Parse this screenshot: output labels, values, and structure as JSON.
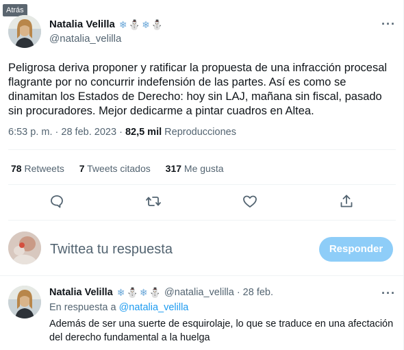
{
  "tooltip": {
    "back": "Atrás"
  },
  "main_tweet": {
    "display_name": "Natalia Velilla",
    "name_emojis": [
      "❄",
      "⛄",
      "❄",
      "⛄"
    ],
    "handle": "@natalia_velilla",
    "more": "···",
    "text": "Peligrosa deriva proponer y ratificar la propuesta de una infracción procesal flagrante por no concurrir indefensión de las partes. Así es como se dinamitan los Estados de Derecho: hoy sin LAJ, mañana sin fiscal, pasado sin procuradores. Mejor dedicarme a pintar cuadros en Altea.",
    "time": "6:53 p. m.",
    "date": "28 feb. 2023",
    "separator": "·",
    "views_count": "82,5 mil",
    "views_label": "Reproducciones",
    "stats": {
      "retweets_count": "78",
      "retweets_label": "Retweets",
      "quotes_count": "7",
      "quotes_label": "Tweets citados",
      "likes_count": "317",
      "likes_label": "Me gusta"
    }
  },
  "actions": [
    "reply-icon",
    "retweet-icon",
    "like-icon",
    "share-icon"
  ],
  "composer": {
    "placeholder": "Twittea tu respuesta",
    "button": "Responder"
  },
  "reply_tweet": {
    "display_name": "Natalia Velilla",
    "name_emojis": [
      "❄",
      "⛄",
      "❄",
      "⛄"
    ],
    "handle": "@natalia_velilla",
    "separator": "·",
    "date": "28 feb.",
    "more": "···",
    "in_reply_prefix": "En respuesta a",
    "in_reply_handle": "@natalia_velilla",
    "text": "Además de ser una suerte de esquirolaje, lo que se traduce en una afectación del derecho fundamental a la huelga"
  },
  "colors": {
    "accent": "#1d9bf0",
    "button_disabled": "#8ecdf8",
    "secondary_text": "#536471"
  }
}
